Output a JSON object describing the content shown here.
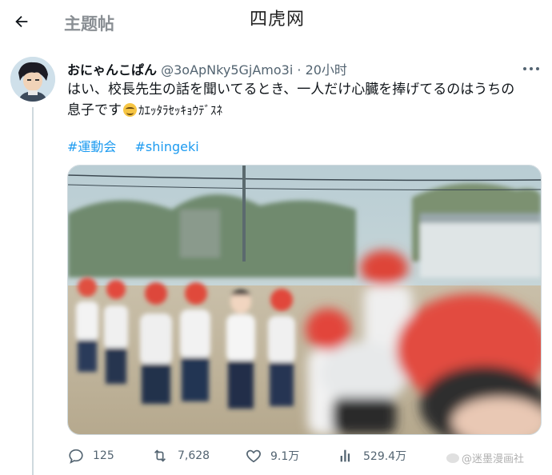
{
  "header": {
    "title": "主题帖",
    "back_icon": "arrow-left-icon"
  },
  "watermark": {
    "top_text": "四虎网",
    "weibo_text": "@迷墨漫画社"
  },
  "tweet": {
    "display_name": "おにゃんこぱん",
    "handle": "@3oApNky5GjAmo3i",
    "separator": "·",
    "time": "20小时",
    "text_line1": "はい、校長先生の話を聞いてるとき、一人だけ心臓を捧げてるのはうちの",
    "text_line2_a": "息子です",
    "text_line2_b": "ｶｴｯﾀﾗｾｯｷｮｳﾃﾞｽﾈ",
    "hashtags": [
      "#運動会",
      "#shingeki"
    ]
  },
  "actions": {
    "reply_count": "125",
    "retweet_count": "7,628",
    "like_count": "9.1万",
    "view_count": "529.4万"
  },
  "colors": {
    "accent": "#1d9bf0",
    "muted": "#536471",
    "border": "#cfd9de"
  }
}
